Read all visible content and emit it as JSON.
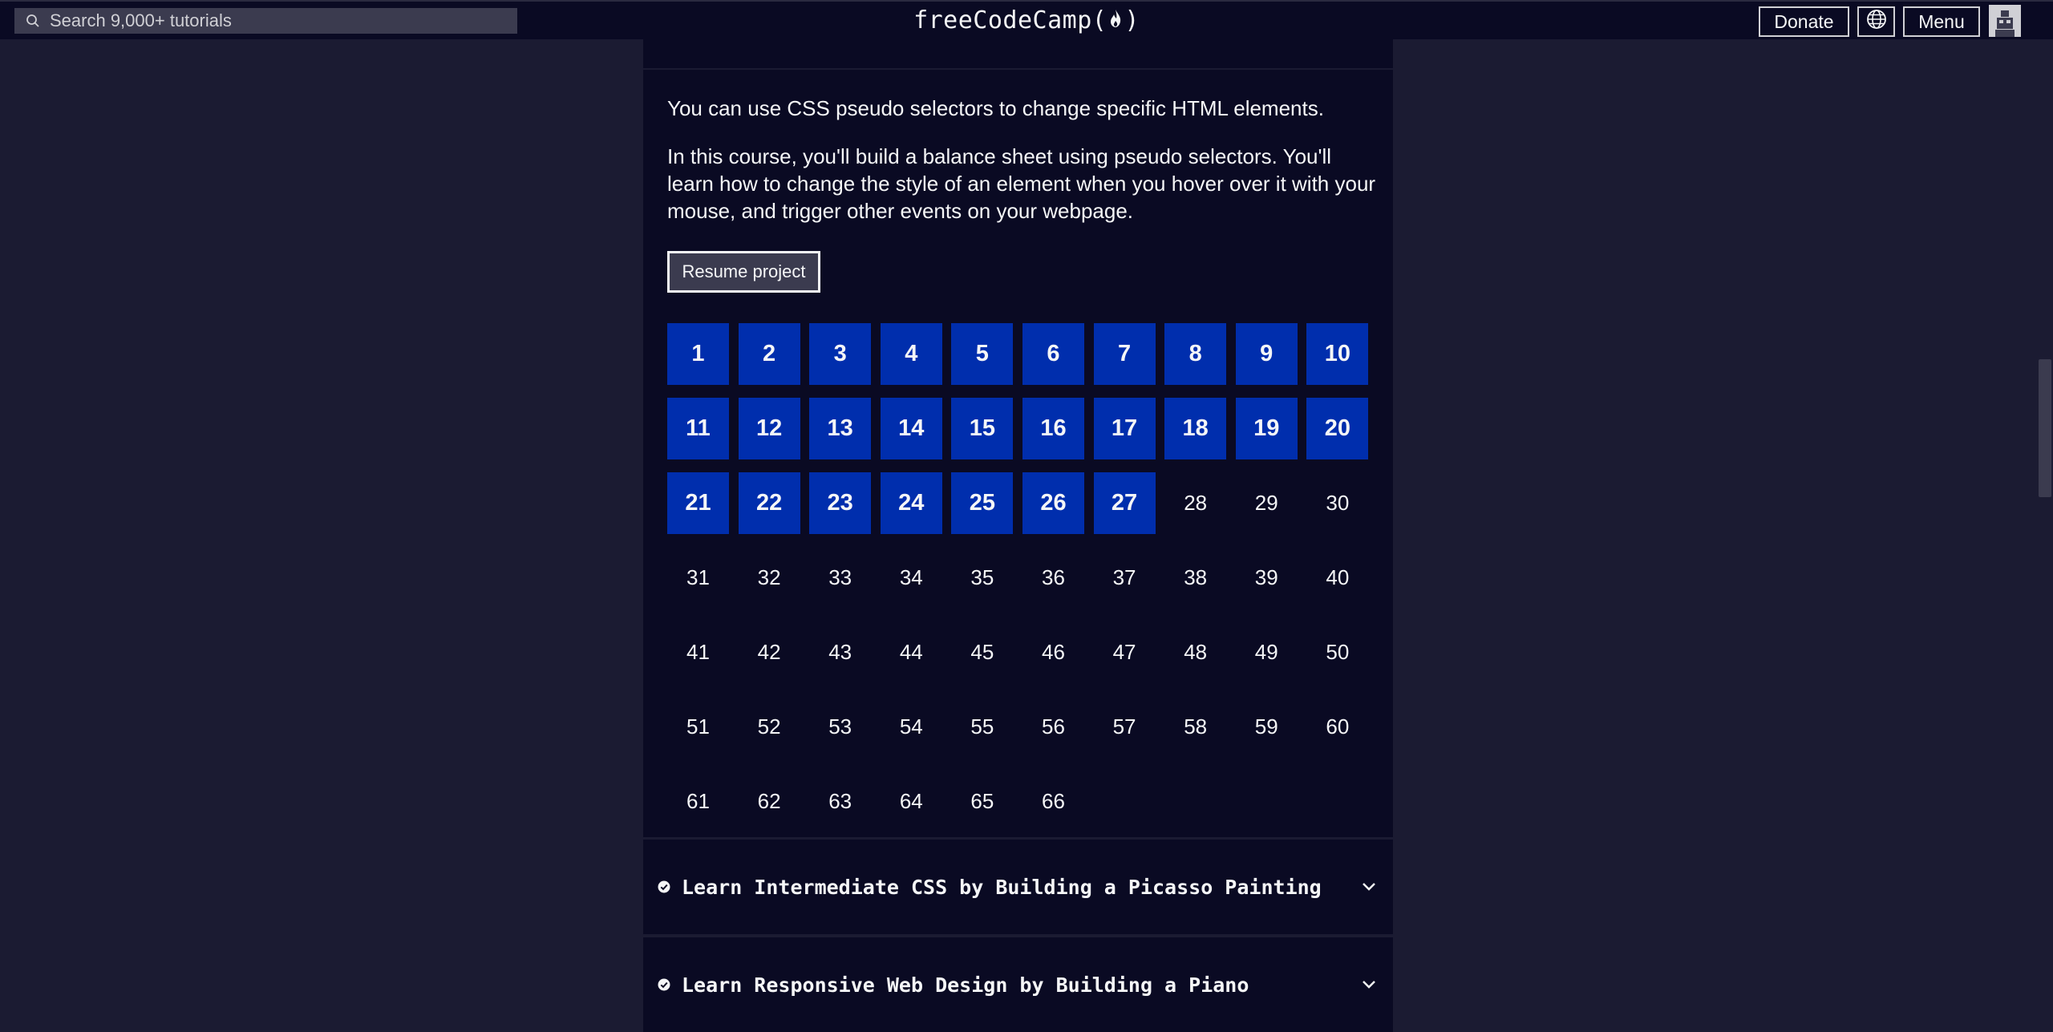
{
  "nav": {
    "search_placeholder": "Search 9,000+ tutorials",
    "logo_left": "freeCodeCamp(",
    "logo_right": ")",
    "donate_label": "Donate",
    "menu_label": "Menu"
  },
  "course": {
    "desc1": "You can use CSS pseudo selectors to change specific HTML elements.",
    "desc2": "In this course, you'll build a balance sheet using pseudo selectors. You'll learn how to change the style of an element when you hover over it with your mouse, and trigger other events on your webpage.",
    "resume_label": "Resume project",
    "steps_total": 66,
    "steps_completed": 27
  },
  "blocks": [
    {
      "title": "Learn Intermediate CSS by Building a Picasso Painting"
    },
    {
      "title": "Learn Responsive Web Design by Building a Piano"
    }
  ],
  "colors": {
    "nav_bg": "#0a0a23",
    "page_bg": "#1b1b32",
    "step_done_bg": "#002ead",
    "text": "#f5f6f7"
  }
}
